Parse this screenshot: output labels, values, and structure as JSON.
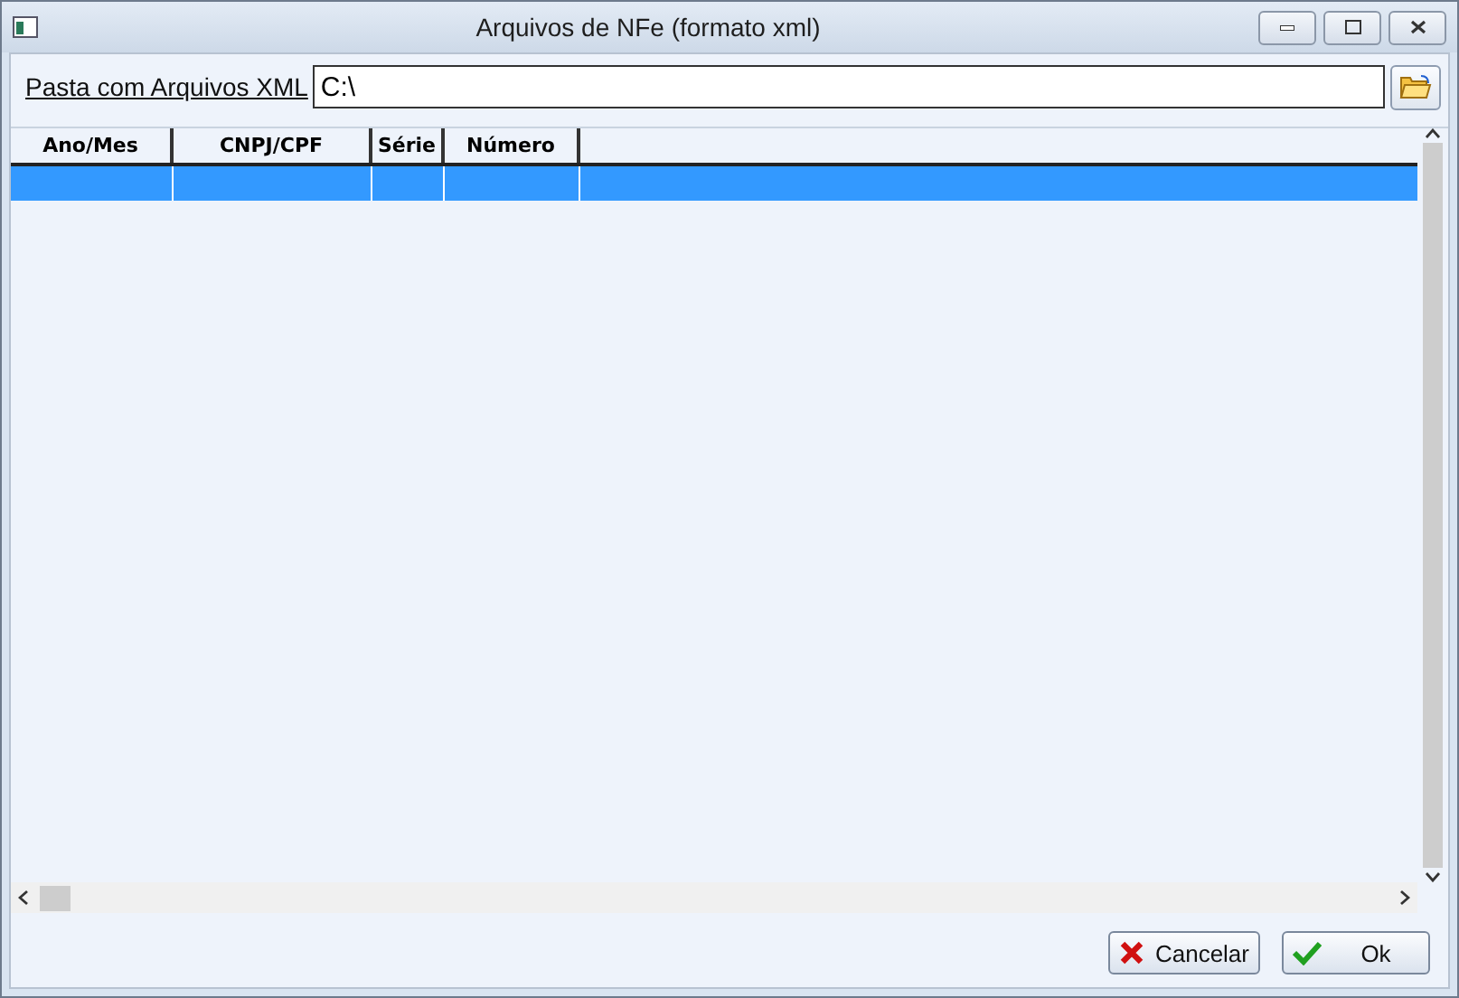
{
  "window": {
    "title": "Arquivos de NFe (formato xml)"
  },
  "folder": {
    "label": "Pasta com Arquivos XML",
    "value": "C:\\"
  },
  "table": {
    "columns": [
      "Ano/Mes",
      "CNPJ/CPF",
      "Série",
      "Número"
    ],
    "rows": [
      {
        "selected": true
      }
    ]
  },
  "buttons": [
    {
      "kind": "cancel",
      "label": "Cancelar"
    },
    {
      "kind": "ok",
      "label": "Ok"
    }
  ]
}
